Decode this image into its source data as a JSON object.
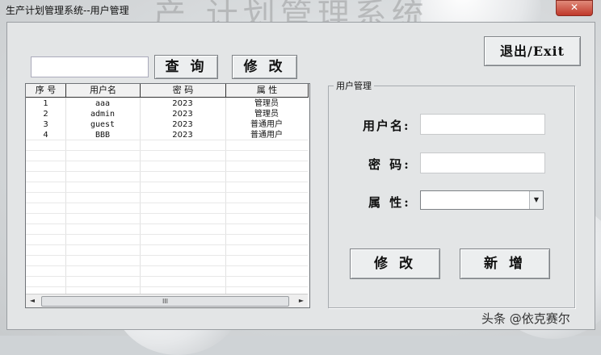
{
  "window": {
    "title": "生产计划管理系统--用户管理"
  },
  "watermark_text": "产 计划管理系统",
  "close_label": "✕",
  "toolbar": {
    "query_label": "查 询",
    "edit_label": "修 改",
    "exit_label": "退出/Exit",
    "search_value": ""
  },
  "table": {
    "columns": [
      "序 号",
      "用户名",
      "密 码",
      "属 性"
    ],
    "rows": [
      [
        "1",
        "aaa",
        "2023",
        "管理员"
      ],
      [
        "2",
        "admin",
        "2023",
        "管理员"
      ],
      [
        "3",
        "guest",
        "2023",
        "普通用户"
      ],
      [
        "4",
        "BBB",
        "2023",
        "普通用户"
      ]
    ],
    "scroll_thumb": "III",
    "scroll_left_icon": "◄",
    "scroll_right_icon": "►"
  },
  "form": {
    "group_title": "用户管理",
    "username_label": "用户名:",
    "password_label": "密 码:",
    "role_label": "属 性:",
    "username_value": "",
    "password_value": "",
    "role_value": "",
    "dropdown_icon": "▼",
    "edit_button": "修 改",
    "add_button": "新 增"
  },
  "footer_text": "头条 @依克赛尔"
}
